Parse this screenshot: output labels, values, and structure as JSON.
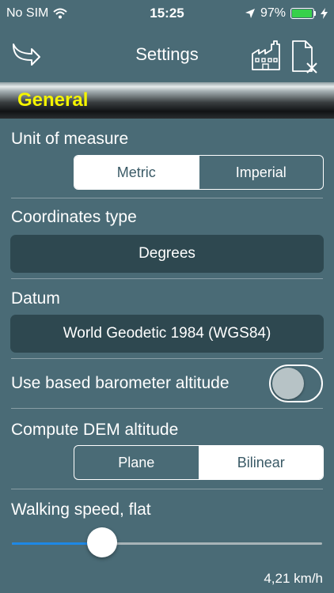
{
  "status_bar": {
    "carrier": "No SIM",
    "time": "15:25",
    "battery_text": "97%",
    "battery_level": 0.97,
    "icons": [
      "wifi-icon",
      "location-arrow-icon",
      "battery-icon",
      "charging-bolt-icon"
    ]
  },
  "nav": {
    "title": "Settings",
    "icons": [
      "back-arrow-icon",
      "factory-reset-icon",
      "clear-document-icon"
    ]
  },
  "section": {
    "title": "General"
  },
  "settings": {
    "unit_of_measure": {
      "label": "Unit of measure",
      "options": [
        "Metric",
        "Imperial"
      ],
      "selected": "Metric"
    },
    "coordinates_type": {
      "label": "Coordinates type",
      "value": "Degrees"
    },
    "datum": {
      "label": "Datum",
      "value": "World Geodetic 1984 (WGS84)"
    },
    "barometer": {
      "label": "Use based barometer altitude",
      "on": false
    },
    "dem_altitude": {
      "label": "Compute DEM altitude",
      "options": [
        "Plane",
        "Bilinear"
      ],
      "selected": "Bilinear"
    },
    "walking_speed": {
      "label": "Walking speed, flat",
      "value_text": "4,21 km/h",
      "fraction": 0.29
    }
  },
  "colors": {
    "background": "#4a6b76",
    "section_title": "#f4f400",
    "picker_bg": "#2e4850",
    "slider_fill": "#1e88e5",
    "battery": "#37d14b"
  }
}
